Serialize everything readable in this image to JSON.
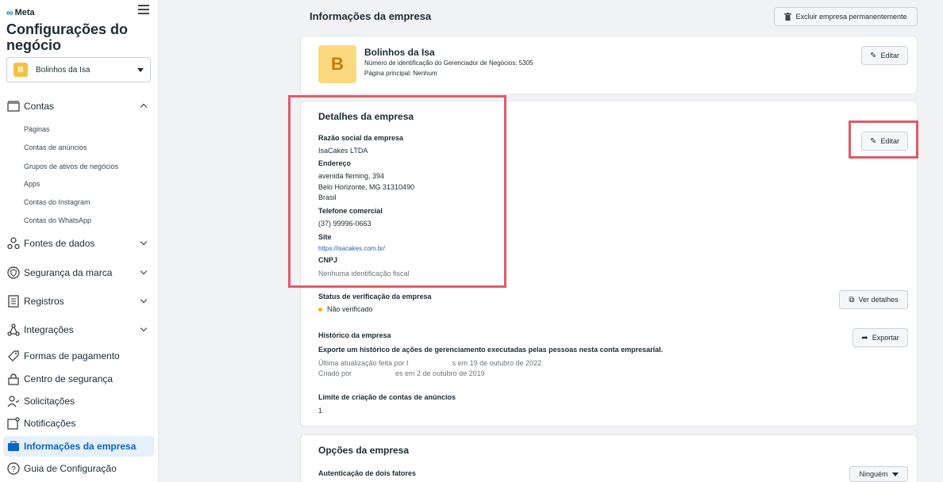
{
  "brand": {
    "logo_text": "Meta"
  },
  "sidebar": {
    "title": "Configurações do negócio",
    "business_selector": {
      "avatar_letter": "B",
      "name": "Bolinhos da Isa"
    },
    "sections": {
      "contas": "Contas",
      "contas_items": [
        "Páginas",
        "Contas de anúncios",
        "Grupos de ativos de negócios",
        "Apps",
        "Contas do Instagram",
        "Contas do WhatsApp"
      ],
      "fontes": "Fontes de dados",
      "seguranca_marca": "Segurança da marca",
      "registros": "Registros",
      "integracoes": "Integrações",
      "pagamento": "Formas de pagamento",
      "centro_seguranca": "Centro de segurança",
      "solicitacoes": "Solicitações",
      "notificacoes": "Notificações",
      "info_empresa": "Informações da empresa",
      "guia": "Guia de Configuração"
    }
  },
  "header": {
    "title": "Informações da empresa",
    "delete_button": "Excluir empresa permanentemente"
  },
  "business_card": {
    "logo_letter": "B",
    "name": "Bolinhos da Isa",
    "id_line": "Número de identificação do Gerenciador de Negócios: 5305",
    "page_line": "Página principal: Nenhum",
    "edit_label": "Editar"
  },
  "details": {
    "title": "Detalhes da empresa",
    "edit_label": "Editar",
    "razao_label": "Razão social da empresa",
    "razao_value": "IsaCakes LTDA",
    "endereco_label": "Endereço",
    "endereco_line1": "avenida fleming, 394",
    "endereco_line2": "Belo Horizonte, MG 31310490",
    "endereco_line3": "Brasil",
    "telefone_label": "Telefone comercial",
    "telefone_value": "(37) 99996-0663",
    "site_label": "Site",
    "site_value": "https://isacakes.com.br/",
    "cnpj_label": "CNPJ",
    "cnpj_value": "Nenhuma identificação fiscal",
    "status_label": "Status de verificação da empresa",
    "status_value": "Não verificado",
    "status_button": "Ver detalhes",
    "historico_label": "Histórico da empresa",
    "historico_desc": "Exporte um histórico de ações de gerenciamento executadas pelas pessoas nesta conta empresarial.",
    "historico_line1_a": "Última atualização feita por I",
    "historico_line1_b": "s em 19 de outubro de 2022",
    "historico_line2_a": "Criado por",
    "historico_line2_b": "es em 2 de outubro de 2019",
    "export_button": "Exportar",
    "limite_label": "Limite de criação de contas de anúncios",
    "limite_value": "1"
  },
  "options": {
    "title": "Opções da empresa",
    "two_factor_label": "Autenticação de dois fatores",
    "two_factor_value": "Ninguém"
  }
}
